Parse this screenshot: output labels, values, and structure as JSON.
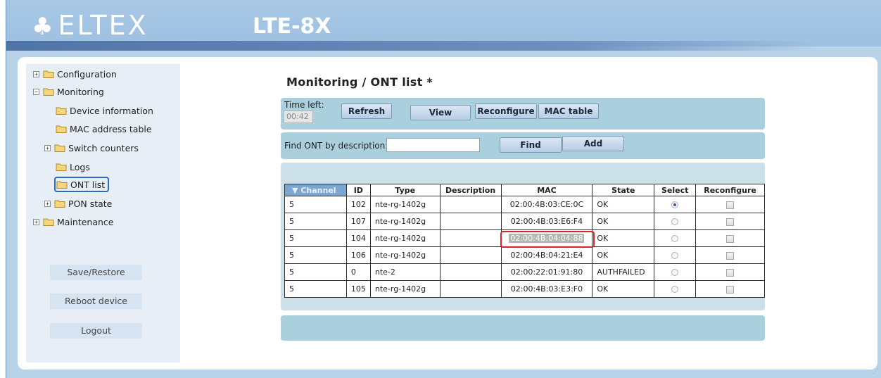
{
  "brand": {
    "logo_text": "ELTEX",
    "model": "LTE-8X"
  },
  "sidebar": {
    "tree": [
      {
        "label": "Configuration",
        "expand": "+"
      },
      {
        "label": "Monitoring",
        "expand": "−"
      },
      {
        "label": "Device information"
      },
      {
        "label": "MAC address table"
      },
      {
        "label": "Switch counters",
        "expand": "+"
      },
      {
        "label": "Logs"
      },
      {
        "label": "ONT list",
        "selected": true
      },
      {
        "label": "PON state",
        "expand": "+"
      },
      {
        "label": "Maintenance",
        "expand": "+"
      }
    ],
    "buttons": [
      "Save/Restore",
      "Reboot device",
      "Logout"
    ]
  },
  "page": {
    "title": "Monitoring / ONT list *",
    "toolbar": {
      "time_left_label": "Time left:",
      "time_left_value": "00:42",
      "refresh": "Refresh",
      "view": "View",
      "reconfigure": "Reconfigure",
      "mac_table": "MAC table"
    },
    "find": {
      "label": "Find ONT by description:",
      "value": "",
      "find_button": "Find",
      "add_button": "Add"
    },
    "table": {
      "sort_indicator": "▼",
      "headers": [
        "Channel",
        "ID",
        "Type",
        "Description",
        "MAC",
        "State",
        "Select",
        "Reconfigure"
      ],
      "rows": [
        {
          "channel": "5",
          "id": "102",
          "type": "nte-rg-1402g",
          "description": "",
          "mac": "02:00:4B:03:CE:0C",
          "state": "OK",
          "selected": true,
          "reconfigure": false
        },
        {
          "channel": "5",
          "id": "107",
          "type": "nte-rg-1402g",
          "description": "",
          "mac": "02:00:4B:03:E6:F4",
          "state": "OK",
          "selected": false,
          "reconfigure": false
        },
        {
          "channel": "5",
          "id": "104",
          "type": "nte-rg-1402g",
          "description": "",
          "mac": "02:00:4B:04:04:88",
          "state": "OK",
          "selected": false,
          "reconfigure": false,
          "highlighted": true
        },
        {
          "channel": "5",
          "id": "106",
          "type": "nte-rg-1402g",
          "description": "",
          "mac": "02:00:4B:04:21:E4",
          "state": "OK",
          "selected": false,
          "reconfigure": false
        },
        {
          "channel": "5",
          "id": "0",
          "type": "nte-2",
          "description": "",
          "mac": "02:00:22:01:91:80",
          "state": "AUTHFAILED",
          "selected": false,
          "reconfigure": false
        },
        {
          "channel": "5",
          "id": "105",
          "type": "nte-rg-1402g",
          "description": "",
          "mac": "02:00:4B:03:E3:F0",
          "state": "OK",
          "selected": false,
          "reconfigure": false
        }
      ]
    }
  }
}
